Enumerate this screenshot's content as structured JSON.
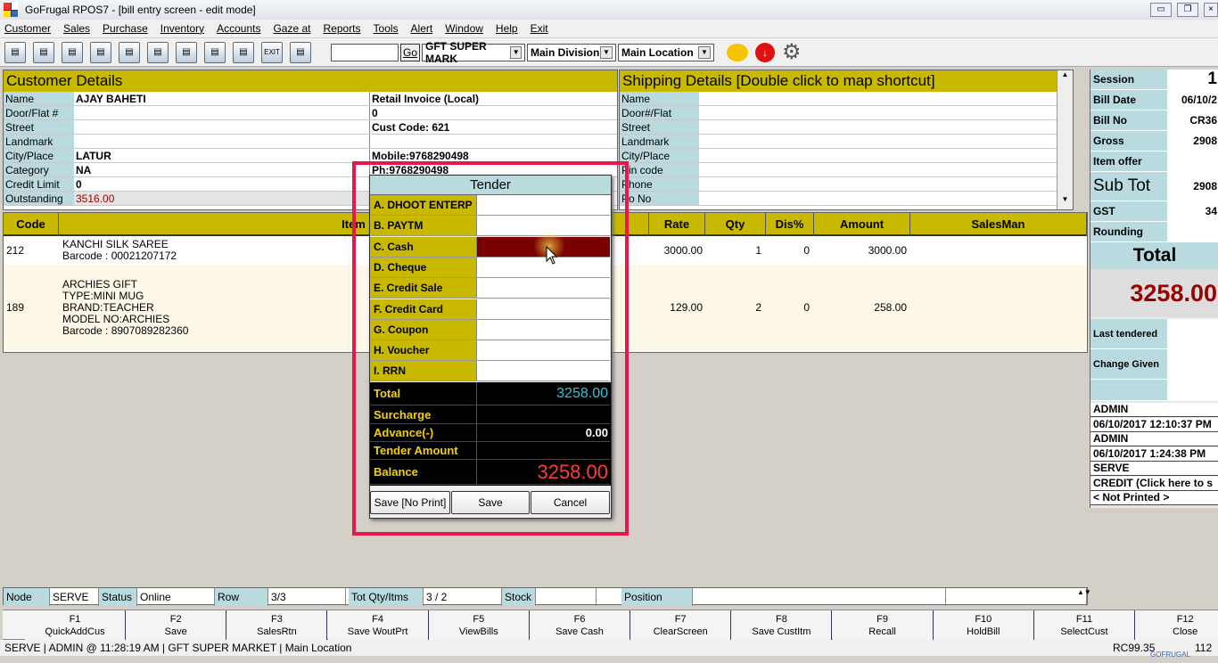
{
  "window": {
    "title": "GoFrugal RPOS7 - [bill entry screen - edit mode]"
  },
  "menu": [
    "Customer",
    "Sales",
    "Purchase",
    "Inventory",
    "Accounts",
    "Gaze at",
    "Reports",
    "Tools",
    "Alert",
    "Window",
    "Help",
    "Exit"
  ],
  "toolbar": {
    "go": "Go",
    "exit_label": "EXIT",
    "search_value": "",
    "store": "GFT SUPER MARK",
    "division": "Main Division",
    "location": "Main Location"
  },
  "customer": {
    "title": "Customer Details",
    "rows": [
      [
        "Name",
        "AJAY BAHETI",
        "Retail Invoice (Local)"
      ],
      [
        "Door/Flat #",
        "",
        "0"
      ],
      [
        "Street",
        "",
        "Cust Code: 621"
      ],
      [
        "Landmark",
        "",
        ""
      ],
      [
        "City/Place",
        "LATUR",
        "Mobile:9768290498"
      ],
      [
        "Category",
        "NA",
        "Ph:9768290498"
      ],
      [
        "Credit Limit",
        "0",
        ""
      ],
      [
        "Outstanding",
        "3516.00",
        ""
      ]
    ]
  },
  "shipping": {
    "title": "Shipping Details   [Double click to map shortcut]",
    "labels": [
      "Name",
      "Door#/Flat",
      "Street",
      "Landmark",
      "City/Place",
      "Pin code",
      "Phone",
      "Po No"
    ]
  },
  "grid": {
    "columns": [
      "Code",
      "Item",
      "Rate",
      "Qty",
      "Dis%",
      "Amount",
      "SalesMan"
    ],
    "rows": [
      {
        "code": "212",
        "item": "KANCHI SILK SAREE\nBarcode : 00021207172",
        "rate": "3000.00",
        "qty": "1",
        "dis": "0",
        "amount": "3000.00"
      },
      {
        "code": "189",
        "item": "ARCHIES GIFT\nTYPE:MINI MUG\nBRAND:TEACHER\nMODEL NO:ARCHIES\nBarcode : 8907089282360",
        "rate": "129.00",
        "qty": "2",
        "dis": "0",
        "amount": "258.00"
      }
    ]
  },
  "summary": {
    "rows": [
      [
        "Session",
        "1"
      ],
      [
        "Bill Date",
        "06/10/2"
      ],
      [
        "Bill No",
        "CR36"
      ],
      [
        "Gross",
        "2908"
      ],
      [
        "Item offer",
        ""
      ],
      [
        "Sub Tot",
        "2908"
      ],
      [
        "GST",
        "34"
      ],
      [
        "Rounding",
        ""
      ]
    ],
    "total_label": "Total",
    "total_value": "3258.00",
    "last_tendered": "Last tendered",
    "change_given": "Change Given",
    "log": [
      "ADMIN",
      "06/10/2017 12:10:37 PM",
      "ADMIN",
      "06/10/2017 1:24:38 PM",
      "SERVE",
      "CREDIT  (Click here to s",
      "< Not Printed >"
    ]
  },
  "tender": {
    "title": "Tender",
    "modes": [
      "A. DHOOT ENTERP",
      "B. PAYTM",
      "C. Cash",
      "D. Cheque",
      "E. Credit Sale",
      "F. Credit Card",
      "G. Coupon",
      "H. Voucher",
      "I. RRN"
    ],
    "totals": [
      [
        "Total",
        "3258.00"
      ],
      [
        "Surcharge",
        ""
      ],
      [
        "Advance(-)",
        "0.00"
      ],
      [
        "Tender Amount",
        ""
      ],
      [
        "Balance",
        "3258.00"
      ]
    ],
    "buttons": [
      "Save [No Print]",
      "Save",
      "Cancel"
    ],
    "selected_color": "#7a0000"
  },
  "status": [
    [
      "Node",
      "SERVE"
    ],
    [
      "Status",
      "Online"
    ],
    [
      "Row",
      "3/3"
    ],
    [
      "Tot Qty/Itms",
      "3 / 2"
    ],
    [
      "Stock",
      ""
    ],
    [
      "Position",
      ""
    ]
  ],
  "fkeys": [
    [
      "F1",
      "QuickAddCus"
    ],
    [
      "F2",
      "Save"
    ],
    [
      "F3",
      "SalesRtn"
    ],
    [
      "F4",
      "Save WoutPrt"
    ],
    [
      "F5",
      "ViewBills"
    ],
    [
      "F6",
      "Save Cash"
    ],
    [
      "F7",
      "ClearScreen"
    ],
    [
      "F8",
      "Save CustItm"
    ],
    [
      "F9",
      "Recall"
    ],
    [
      "F10",
      "HoldBill"
    ],
    [
      "F11",
      "SelectCust"
    ],
    [
      "F12",
      "Close"
    ]
  ],
  "footer": {
    "left": "SERVE | ADMIN  @ 11:28:19 AM   | GFT SUPER MARKET   | Main Location",
    "version": "RC99.35",
    "right": "112",
    "brand": "GOFRUGAL"
  }
}
